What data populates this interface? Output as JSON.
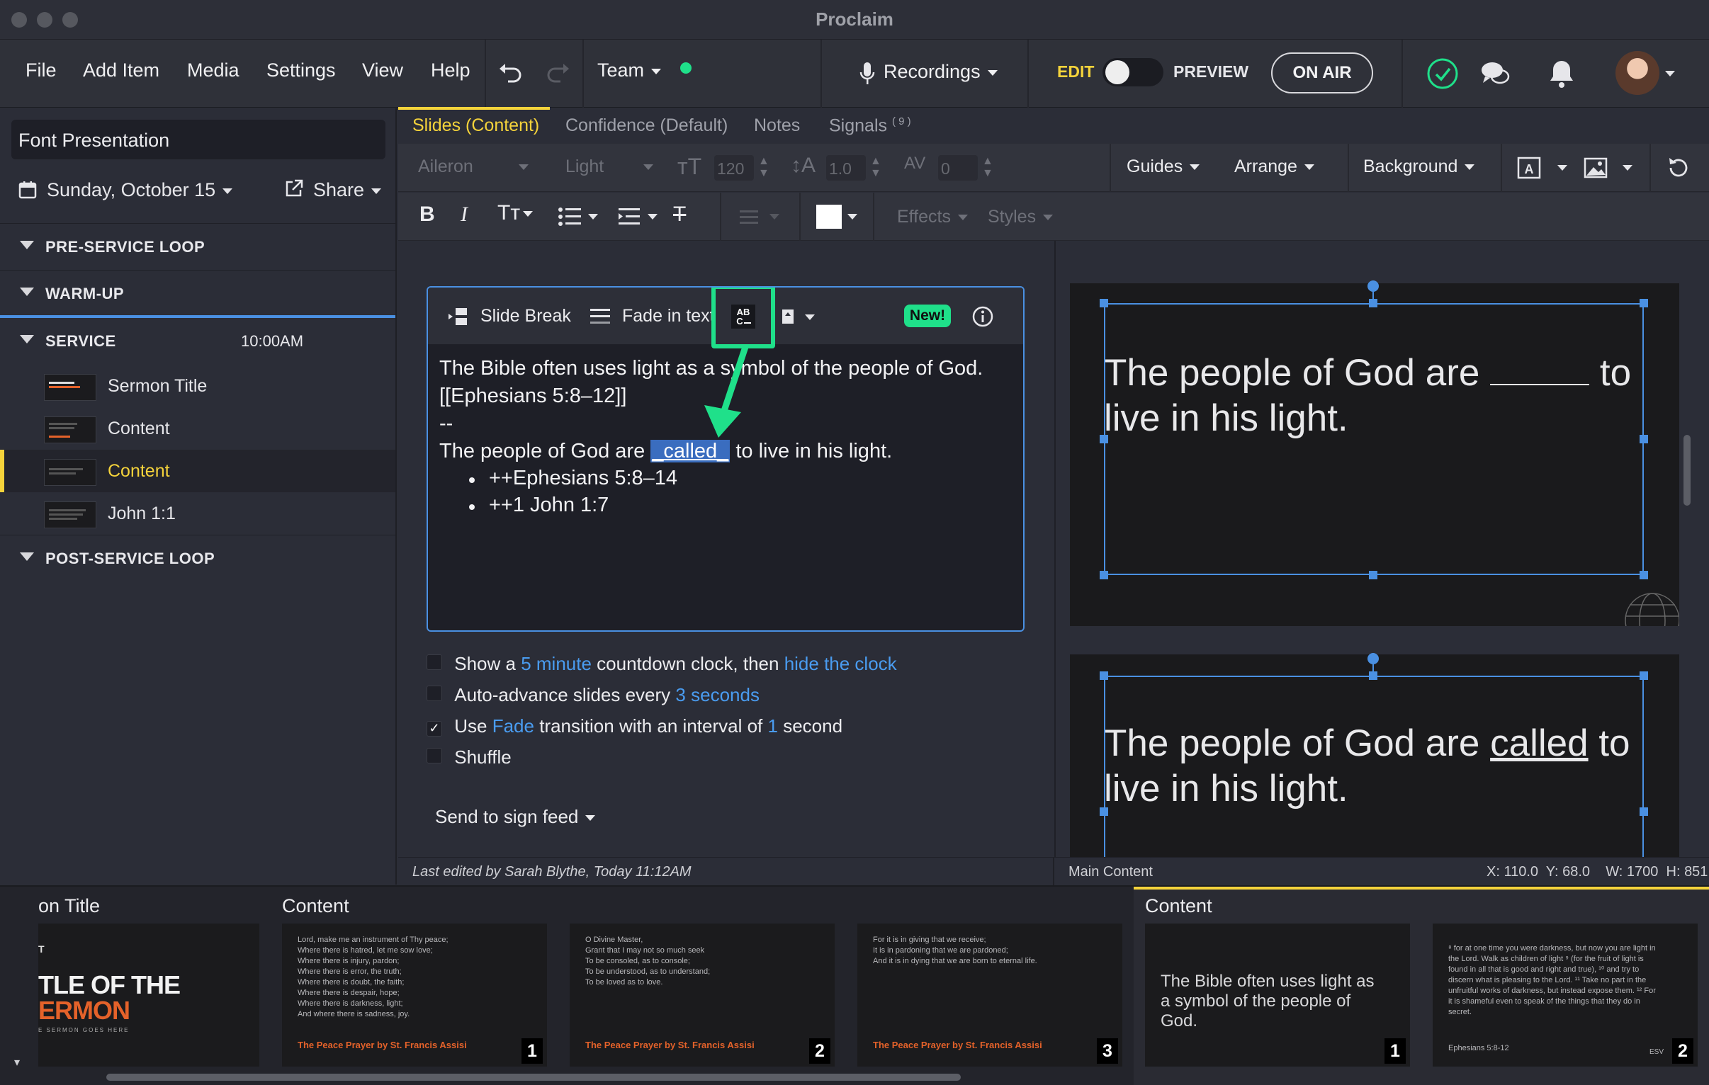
{
  "window": {
    "title": "Proclaim"
  },
  "menu": {
    "items": [
      "File",
      "Add Item",
      "Media",
      "Settings",
      "View",
      "Help"
    ],
    "team_label": "Team",
    "recordings_label": "Recordings",
    "edit_label": "EDIT",
    "preview_label": "PREVIEW",
    "on_air_label": "ON AIR"
  },
  "sidebar": {
    "presentation_name": "Font Presentation",
    "date": "Sunday, October 15",
    "share_label": "Share",
    "sections": {
      "pre_service": "PRE-SERVICE LOOP",
      "warm_up": "WARM-UP",
      "service": "SERVICE",
      "service_time": "10:00AM",
      "post_service": "POST-SERVICE LOOP"
    },
    "service_items": [
      "Sermon Title",
      "Content",
      "Content",
      "John 1:1"
    ]
  },
  "tabs": {
    "slides": "Slides (Content)",
    "confidence": "Confidence (Default)",
    "notes": "Notes",
    "signals": "Signals",
    "signals_badge": "( 9 )"
  },
  "toolbar": {
    "font": "Aileron",
    "weight": "Light",
    "font_size": "120",
    "line_height": "1.0",
    "letter_spacing": "0",
    "guides": "Guides",
    "arrange": "Arrange",
    "background": "Background",
    "effects": "Effects",
    "styles": "Styles",
    "highlight_color": "#ffffff"
  },
  "editor": {
    "slide_break": "Slide Break",
    "fade_in_text": "Fade in text",
    "new_badge": "New!",
    "line1": "The Bible often uses light as a symbol of the people of God.",
    "line2": "[[Ephesians 5:8–12]]",
    "line3": "--",
    "line4_pre": "The people of God are ",
    "line4_sel": "_called_",
    "line4_post": " to live in his light.",
    "bullet1": "++Ephesians 5:8–14",
    "bullet2": "++1 John 1:7"
  },
  "options": {
    "o1_a": "Show a",
    "o1_link1": "5 minute",
    "o1_b": "countdown clock, then",
    "o1_link2": "hide the clock",
    "o1_checked": false,
    "o2_a": "Auto-advance slides every",
    "o2_link": "3 seconds",
    "o2_checked": false,
    "o3_a": "Use",
    "o3_link1": "Fade",
    "o3_b": "transition with an interval of",
    "o3_link2": "1",
    "o3_c": "second",
    "o3_checked": true,
    "o4": "Shuffle",
    "o4_checked": false,
    "send_to_sign_feed": "Send to sign feed"
  },
  "preview": {
    "slide1_a": "The people of God are",
    "slide1_blank": "______",
    "slide1_b": "to",
    "slide1_c": "live in his light.",
    "slide2_a": "The people of God are",
    "slide2_word": "called",
    "slide2_b": "to",
    "slide2_c": "live in his light."
  },
  "status": {
    "last_edited": "Last edited by Sarah Blythe, Today 11:12AM",
    "main_content": "Main Content",
    "coords": "X: 110.0  Y: 68.0    W: 1700  H: 851"
  },
  "filmstrip": {
    "group1_title": "on Title",
    "group2_title": "Content",
    "group3_title": "Content",
    "sermon_title_line1": "TLE OF THE",
    "sermon_title_line2": "ERMON",
    "sermon_small": "E SERMON GOES HERE",
    "prayer1": "Lord, make me an instrument of Thy peace;\nWhere there is hatred, let me sow love;\nWhere there is injury, pardon;\nWhere there is error, the truth;\nWhere there is doubt, the faith;\nWhere there is despair, hope;\nWhere there is darkness, light;\nAnd where there is sadness, joy.",
    "prayer2": "O Divine Master,\nGrant that I may not so much seek\nTo be consoled, as to console;\nTo be understood, as to understand;\nTo be loved as to love.",
    "prayer3": "For it is in giving that we receive;\nIt is in pardoning that we are pardoned;\nAnd it is in dying that we are born to eternal life.",
    "prayer_credit": "The Peace Prayer by St. Francis Assisi",
    "content_slide_text": "The Bible often uses light as a symbol of the people of God.",
    "eph_text": "⁸ for at one time you were darkness, but now you are light in\nthe Lord. Walk as children of light ⁹ (for the fruit of light is\nfound in all that is good and right and true), ¹⁰ and try to\ndiscern what is pleasing to the Lord. ¹¹ Take no part in the\nunfruitful works of darkness, but instead expose them. ¹² For\nit is shameful even to speak of the things that they do in\nsecret.",
    "eph_ref": "Ephesians 5:8-12",
    "eph_version": "ESV",
    "nums": [
      "1",
      "2",
      "3",
      "1",
      "2"
    ]
  },
  "colors": {
    "accent_yellow": "#f5d33b",
    "accent_green": "#1fe08a",
    "link_blue": "#4a9cf0",
    "selection_blue": "#4a90e2"
  }
}
